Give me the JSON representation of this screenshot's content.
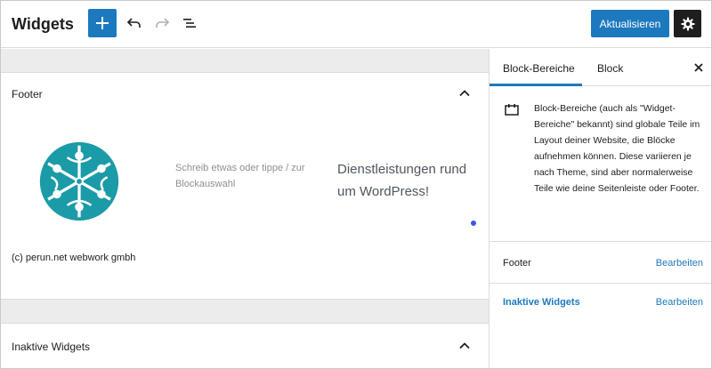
{
  "header": {
    "title": "Widgets",
    "update_label": "Aktualisieren",
    "icons": [
      "plus-icon",
      "undo-icon",
      "redo-icon",
      "list-view-icon",
      "gear-icon"
    ]
  },
  "main": {
    "footer_panel": {
      "title": "Footer",
      "placeholder": "Schreib etwas oder tippe / zur Blockauswahl",
      "promo_text": "Dienstleistungen rund um WordPress!",
      "copyright": "(c) perun.net webwork gmbh"
    },
    "inactive_panel": {
      "title": "Inaktive Widgets"
    }
  },
  "sidebar": {
    "tabs": [
      {
        "label": "Block-Bereiche",
        "active": true
      },
      {
        "label": "Block",
        "active": false
      }
    ],
    "description": "Block-Bereiche (auch als \"Widget-Bereiche\" bekannt) sind globale Teile im Layout deiner Website, die Blöcke aufnehmen können. Diese variieren je nach Theme, sind aber normalerweise Teile wie deine Seitenleiste oder Footer.",
    "areas": [
      {
        "label": "Footer",
        "action": "Bearbeiten"
      },
      {
        "label": "Inaktive Widgets",
        "action": "Bearbeiten"
      }
    ]
  },
  "colors": {
    "accent": "#1d79be",
    "logo": "#1a9ba7",
    "dark": "#1e1e1e"
  }
}
